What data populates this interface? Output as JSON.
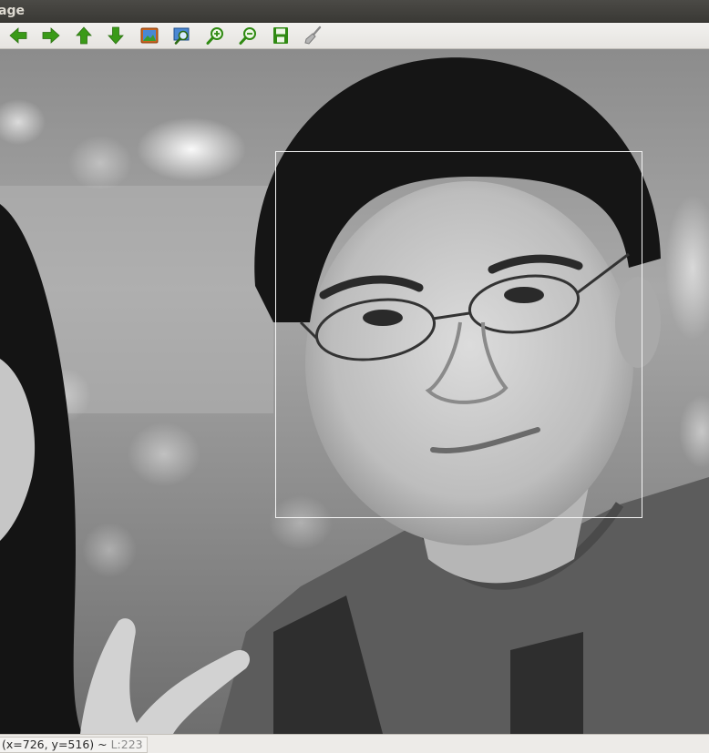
{
  "window": {
    "title": "age"
  },
  "toolbar": {
    "buttons": [
      {
        "name": "pan-left",
        "icon": "arrow-left-icon"
      },
      {
        "name": "pan-right",
        "icon": "arrow-right-icon"
      },
      {
        "name": "pan-up",
        "icon": "arrow-up-icon"
      },
      {
        "name": "pan-down",
        "icon": "arrow-down-icon"
      },
      {
        "name": "fit-image",
        "icon": "image-icon"
      },
      {
        "name": "zoom-area",
        "icon": "zoom-area-icon"
      },
      {
        "name": "zoom-in",
        "icon": "zoom-in-icon"
      },
      {
        "name": "zoom-out",
        "icon": "zoom-out-icon"
      },
      {
        "name": "save",
        "icon": "save-icon"
      },
      {
        "name": "properties",
        "icon": "brush-icon"
      }
    ],
    "icon_color": "#3a9a18"
  },
  "image": {
    "content": "grayscale portrait photo",
    "overlay_color": "#f4f4f4"
  },
  "status": {
    "coords": "(x=726, y=516) ~ ",
    "luminance": "L:223"
  }
}
